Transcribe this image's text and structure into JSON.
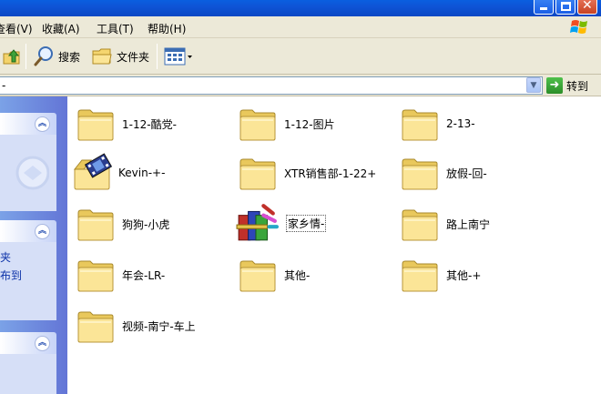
{
  "menubar": {
    "items": [
      "查看(V)",
      "收藏(A)",
      "工具(T)",
      "帮助(H)"
    ]
  },
  "toolbar": {
    "search_label": "搜索",
    "folders_label": "文件夹"
  },
  "address": {
    "value": "-",
    "go_label": "转到"
  },
  "leftpane": {
    "link1": "夹",
    "link2": "布到"
  },
  "files": [
    {
      "name": "1-12-酷党-",
      "icon": "folder-icon"
    },
    {
      "name": "1-12-图片",
      "icon": "folder-icon"
    },
    {
      "name": "2-13-",
      "icon": "folder-icon"
    },
    {
      "name": "Kevin-+-",
      "icon": "video-folder-icon"
    },
    {
      "name": "XTR销售部-1-22+",
      "icon": "folder-icon"
    },
    {
      "name": "放假-回-",
      "icon": "folder-icon"
    },
    {
      "name": "狗狗-小虎",
      "icon": "folder-icon"
    },
    {
      "name": "家乡情-",
      "icon": "winrar-archive-icon"
    },
    {
      "name": "路上南宁",
      "icon": "folder-icon"
    },
    {
      "name": "年会-LR-",
      "icon": "folder-icon"
    },
    {
      "name": "其他-",
      "icon": "folder-icon"
    },
    {
      "name": "其他-+",
      "icon": "folder-icon"
    },
    {
      "name": "视频-南宁-车上",
      "icon": "folder-icon"
    }
  ]
}
